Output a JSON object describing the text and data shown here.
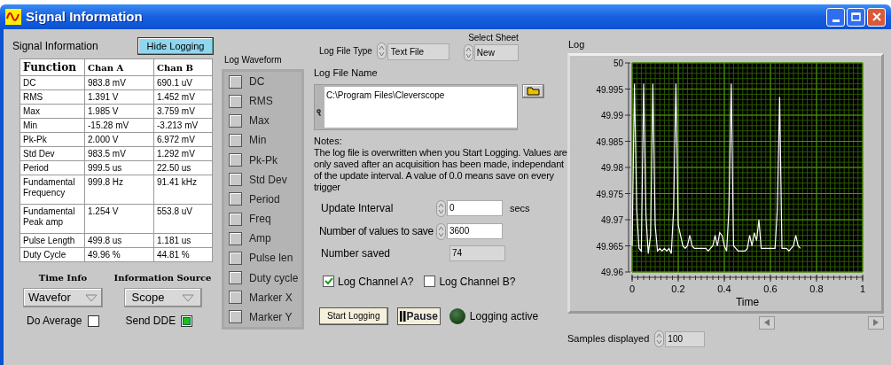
{
  "window": {
    "title": "Signal Information"
  },
  "signal_panel": {
    "label": "Signal Information",
    "hide_button": "Hide Logging"
  },
  "table": {
    "columns": [
      "Function",
      "Chan A",
      "Chan B"
    ],
    "rows": [
      [
        "DC",
        "983.8 mV",
        "690.1 uV"
      ],
      [
        "RMS",
        "1.391 V",
        "1.452 mV"
      ],
      [
        "Max",
        "1.985 V",
        "3.759 mV"
      ],
      [
        "Min",
        "-15.28 mV",
        "-3.213 mV"
      ],
      [
        "Pk-Pk",
        "2.000 V",
        "6.972 mV"
      ],
      [
        "Std Dev",
        "983.5 mV",
        "1.292 mV"
      ],
      [
        "Period",
        "999.5 us",
        "22.50 us"
      ],
      [
        "Fundamental Frequency",
        "999.8 Hz",
        "91.41 kHz"
      ],
      [
        "Fundamental Peak amp",
        "1.254 V",
        "553.8 uV"
      ],
      [
        "Pulse Length",
        "499.8 us",
        "1.181 us"
      ],
      [
        "Duty Cycle",
        "49.96 %",
        "44.81 %"
      ]
    ]
  },
  "time_info": {
    "label": "Time Info",
    "value": "Wavefor"
  },
  "information_source": {
    "label": "Information Source",
    "value": "Scope"
  },
  "do_average": {
    "label": "Do Average",
    "checked": false
  },
  "send_dde": {
    "label": "Send DDE",
    "checked": true
  },
  "log_waveform": {
    "label": "Log Waveform",
    "items": [
      {
        "label": "DC",
        "checked": false
      },
      {
        "label": "RMS",
        "checked": false
      },
      {
        "label": "Max",
        "checked": false
      },
      {
        "label": "Min",
        "checked": false
      },
      {
        "label": "Pk-Pk",
        "checked": false
      },
      {
        "label": "Std Dev",
        "checked": false
      },
      {
        "label": "Period",
        "checked": false
      },
      {
        "label": "Freq",
        "checked": false
      },
      {
        "label": "Amp",
        "checked": false
      },
      {
        "label": "Pulse len",
        "checked": false
      },
      {
        "label": "Duty cycle",
        "checked": false
      },
      {
        "label": "Marker X",
        "checked": false
      },
      {
        "label": "Marker Y",
        "checked": false
      }
    ]
  },
  "log_file_type": {
    "label": "Log File Type",
    "value": "Text File"
  },
  "select_sheet": {
    "label": "Select Sheet",
    "value": "New"
  },
  "log_file_name": {
    "label": "Log File Name",
    "value": "C:\\Program Files\\Cleverscope"
  },
  "notes": {
    "title": "Notes:",
    "text": "The log file is overwritten when you Start Logging. Values are only saved after an acquisition has been made, independant of the update interval. A value of 0.0 means save on every trigger"
  },
  "update_interval": {
    "label": "Update Interval",
    "value": "0",
    "unit": "secs"
  },
  "values_to_save": {
    "label": "Number of values to save",
    "value": "3600"
  },
  "number_saved": {
    "label": "Number saved",
    "value": "74"
  },
  "log_channel_a": {
    "label": "Log Channel A?",
    "checked": true
  },
  "log_channel_b": {
    "label": "Log Channel B?",
    "checked": false
  },
  "start_button": "Start Logging",
  "pause_button": "Pause",
  "logging_indicator": {
    "label": "Logging active",
    "on": false
  },
  "log": {
    "title": "Log",
    "chart_data": {
      "type": "line",
      "xlabel": "Time",
      "grid": true,
      "xlim": [
        0,
        1
      ],
      "ylim": [
        49.96,
        50
      ],
      "xticks": [
        0,
        0.2,
        0.4,
        0.6,
        0.8,
        1
      ],
      "yticks": [
        49.96,
        49.965,
        49.97,
        49.975,
        49.98,
        49.985,
        49.99,
        49.995,
        50
      ],
      "x": [
        0,
        0.01,
        0.02,
        0.03,
        0.04,
        0.05,
        0.06,
        0.07,
        0.08,
        0.09,
        0.1,
        0.11,
        0.12,
        0.13,
        0.14,
        0.15,
        0.16,
        0.17,
        0.18,
        0.19,
        0.2,
        0.21,
        0.22,
        0.23,
        0.24,
        0.25,
        0.26,
        0.27,
        0.28,
        0.29,
        0.3,
        0.31,
        0.32,
        0.33,
        0.34,
        0.35,
        0.36,
        0.37,
        0.38,
        0.39,
        0.4,
        0.41,
        0.42,
        0.43,
        0.44,
        0.45,
        0.46,
        0.47,
        0.48,
        0.49,
        0.5,
        0.51,
        0.52,
        0.53,
        0.54,
        0.55,
        0.56,
        0.57,
        0.58,
        0.59,
        0.6,
        0.61,
        0.62,
        0.63,
        0.64,
        0.65,
        0.66,
        0.67,
        0.68,
        0.69,
        0.7,
        0.71,
        0.72,
        0.73
      ],
      "series": [
        {
          "color": "#ffffff",
          "values": [
            49.965,
            49.996,
            49.972,
            49.9645,
            49.964,
            49.996,
            49.971,
            49.9635,
            49.967,
            49.996,
            49.969,
            49.964,
            49.9645,
            49.964,
            49.9645,
            49.964,
            49.9645,
            49.9635,
            49.972,
            49.996,
            49.969,
            49.967,
            49.965,
            49.9645,
            49.965,
            49.967,
            49.965,
            49.9645,
            49.9645,
            49.9645,
            49.9645,
            49.9645,
            49.9645,
            49.964,
            49.9645,
            49.965,
            49.967,
            49.965,
            49.9675,
            49.967,
            49.965,
            49.964,
            49.972,
            49.996,
            49.965,
            49.9645,
            49.964,
            49.964,
            49.964,
            49.964,
            49.9645,
            49.967,
            49.965,
            49.9675,
            49.966,
            49.97,
            49.9645,
            49.9645,
            49.9645,
            49.9645,
            49.9645,
            49.9645,
            49.9645,
            49.972,
            49.9935,
            49.9645,
            49.9645,
            49.9645,
            49.964,
            49.9645,
            49.965,
            49.967,
            49.965,
            49.9645
          ]
        }
      ]
    }
  },
  "samples_displayed": {
    "label": "Samples displayed",
    "value": "100"
  }
}
